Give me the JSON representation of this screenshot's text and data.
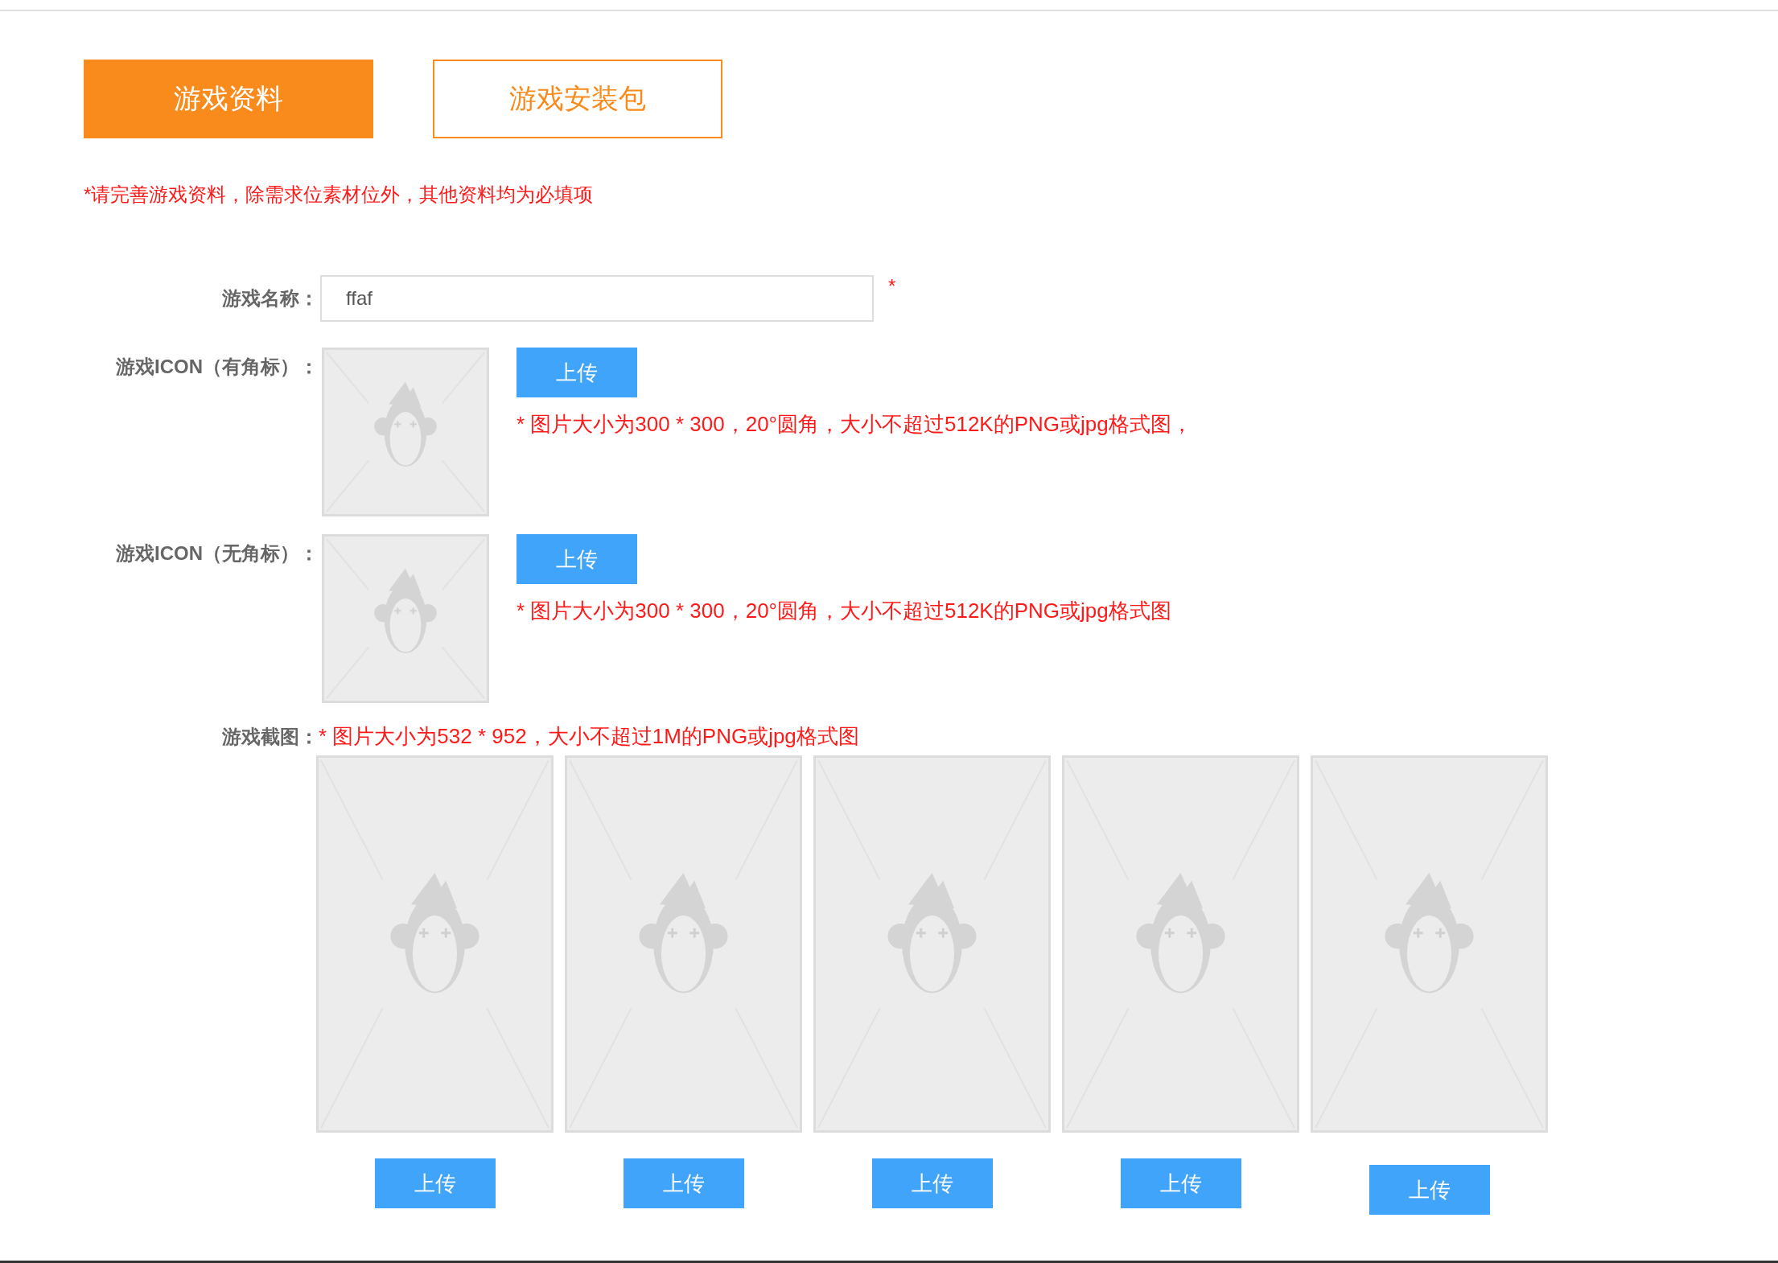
{
  "tabs": [
    {
      "label": "游戏资料",
      "selected": true
    },
    {
      "label": "游戏安装包",
      "selected": false
    }
  ],
  "notice": "*请完善游戏资料，除需求位素材位外，其他资料均为必填项",
  "name_field": {
    "label": "游戏名称：",
    "value": "ffaf",
    "required_mark": "*"
  },
  "icon_uploads": [
    {
      "label": "游戏ICON（有角标）：",
      "button": "上传",
      "hint": "* 图片大小为300 * 300，20°圆角，大小不超过512K的PNG或jpg格式图，"
    },
    {
      "label": "游戏ICON（无角标）：",
      "button": "上传",
      "hint": "* 图片大小为300 * 300，20°圆角，大小不超过512K的PNG或jpg格式图"
    }
  ],
  "screenshots": {
    "label": "游戏截图：",
    "hint": "* 图片大小为532 * 952，大小不超过1M的PNG或jpg格式图",
    "slots": [
      {
        "button": "上传"
      },
      {
        "button": "上传"
      },
      {
        "button": "上传"
      },
      {
        "button": "上传"
      },
      {
        "button": "上传"
      }
    ]
  }
}
